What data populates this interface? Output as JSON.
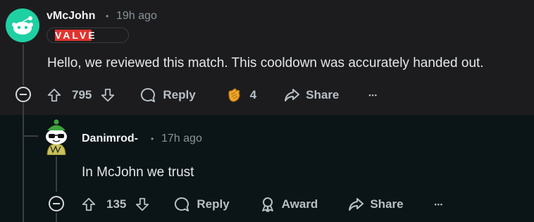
{
  "comment1": {
    "username": "vMcJohn",
    "separator": "•",
    "time": "19h ago",
    "flair": "VALVE",
    "body": "Hello, we reviewed this match. This cooldown was accurately handed out.",
    "score": "795",
    "reply_label": "Reply",
    "award_count": "4",
    "share_label": "Share",
    "more_label": "•••"
  },
  "comment2": {
    "username": "Danimrod-",
    "separator": "•",
    "time": "17h ago",
    "body": "In McJohn we trust",
    "score": "135",
    "reply_label": "Reply",
    "award_label": "Award",
    "share_label": "Share",
    "more_label": "•••"
  },
  "colors": {
    "panel_bg": "#1c1c1e",
    "page_bg": "#0b1416",
    "valve_red": "#e1332f",
    "avatar1": "#1fd0a3",
    "avatar2_hat": "#3da33d"
  }
}
